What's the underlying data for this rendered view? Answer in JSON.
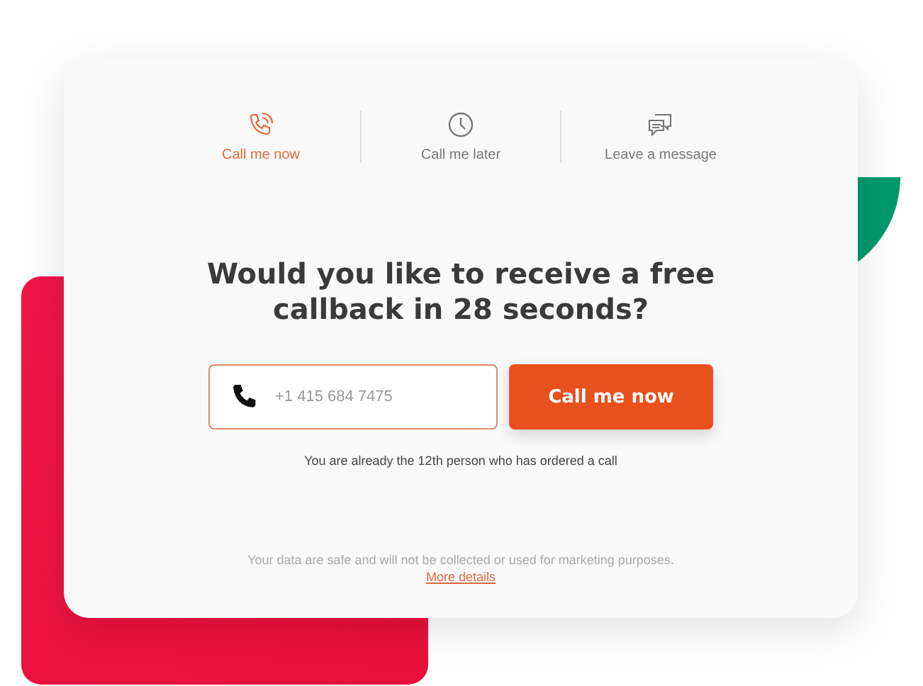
{
  "tabs": [
    {
      "kind": "phone",
      "label": "Call me now",
      "selected": true
    },
    {
      "kind": "clock",
      "label": "Call me later",
      "selected": false
    },
    {
      "kind": "message",
      "label": "Leave a message",
      "selected": false
    }
  ],
  "heading": "Would you like to receive a free callback in 28 seconds?",
  "phone_field": {
    "placeholder": "+1 415 684 7475"
  },
  "call_button": "Call me now",
  "note": "You are already the 12th person who has ordered a call",
  "privacy": {
    "text": "Your data are safe and will not be collected or used for marketing purposes.",
    "link": "More details"
  }
}
